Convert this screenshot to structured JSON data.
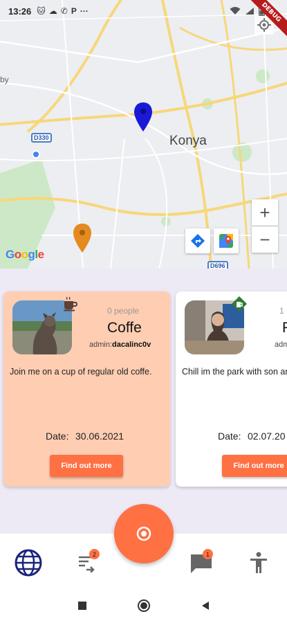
{
  "status_bar": {
    "time": "13:26",
    "icons": [
      "cat-icon",
      "cloud-icon",
      "whatsapp-icon",
      "parking-icon",
      "more-icon"
    ],
    "right_icons": [
      "wifi-icon",
      "signal-icon",
      "battery-icon"
    ]
  },
  "debug_banner": "DEBUG",
  "map": {
    "city": "Konya",
    "partial_place": "by",
    "road_shields": [
      "D330",
      "D696"
    ],
    "google_letters": [
      "G",
      "o",
      "o",
      "g",
      "l",
      "e"
    ],
    "zoom_in": "+",
    "zoom_out": "−",
    "marker_colors": {
      "blue": "#1a1ad6",
      "orange": "#e58a1f"
    }
  },
  "events": [
    {
      "people": "0 people",
      "title": "Coffe",
      "admin_prefix": "admin:",
      "admin_name": "dacalinc0v",
      "description": "Join me on a cup of regular old coffe.",
      "date_label": "Date:",
      "date_value": "30.06.2021",
      "button": "Find out more",
      "category_icon": "coffee-icon"
    },
    {
      "people": "1",
      "title": "P",
      "admin_prefix": "adm",
      "admin_name": "",
      "description": "Chill im the park with son and beers",
      "date_label": "Date:",
      "date_value": "02.07.20",
      "button": "Find out more",
      "category_icon": "beer-icon"
    }
  ],
  "bottom_nav": {
    "swap_badge": "2",
    "chat_badge": "1"
  },
  "colors": {
    "accent": "#ff7043",
    "card_highlight": "#ffcdb2",
    "events_bg": "#ede9f5",
    "globe": "#1a237e"
  }
}
